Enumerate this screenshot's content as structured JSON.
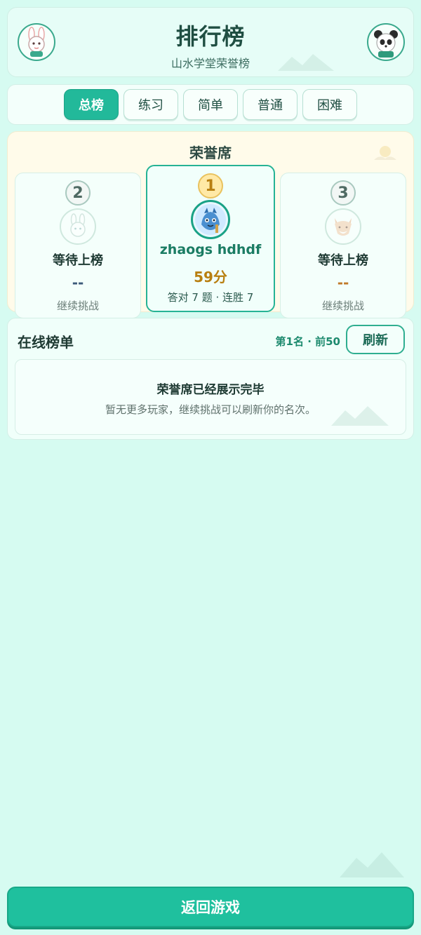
{
  "header": {
    "title": "排行榜",
    "subtitle": "山水学堂荣誉榜"
  },
  "tabs": [
    {
      "label": "总榜",
      "active": true
    },
    {
      "label": "练习",
      "active": false
    },
    {
      "label": "简单",
      "active": false
    },
    {
      "label": "普通",
      "active": false
    },
    {
      "label": "困难",
      "active": false
    }
  ],
  "honor": {
    "title": "荣誉席",
    "podium": [
      {
        "rank": "2",
        "name": "等待上榜",
        "score": "--",
        "stat": "继续挑战",
        "avatar": "rabbit-avatar"
      },
      {
        "rank": "1",
        "name": "zhaogs hdhdf",
        "score": "59分",
        "stat": "答对 7 题 · 连胜 7",
        "avatar": "dragon-avatar"
      },
      {
        "rank": "3",
        "name": "等待上榜",
        "score": "--",
        "stat": "继续挑战",
        "avatar": "fox-avatar"
      }
    ]
  },
  "online": {
    "title": "在线榜单",
    "meta": "第1名 · 前50",
    "refresh_label": "刷新",
    "empty_title": "荣誉席已经展示完毕",
    "empty_desc": "暂无更多玩家，继续挑战可以刷新你的名次。"
  },
  "back_label": "返回游戏",
  "colors": {
    "accent": "#22b99a",
    "background": "#d6fbf1",
    "gold": "#b87f10"
  }
}
